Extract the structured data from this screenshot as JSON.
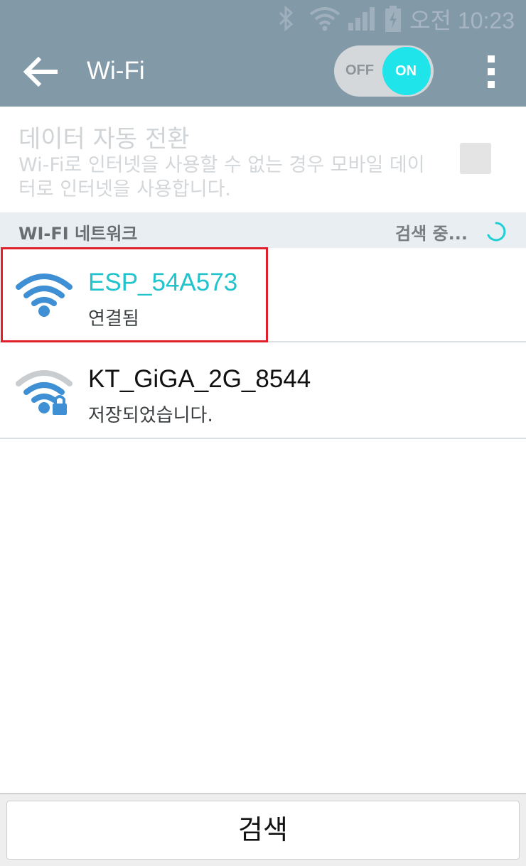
{
  "status_bar": {
    "time": "오전 10:23",
    "icons": [
      "bluetooth-icon",
      "wifi-signal-icon",
      "cell-signal-icon",
      "battery-charging-icon"
    ]
  },
  "app_bar": {
    "title": "Wi-Fi",
    "toggle": {
      "off_label": "OFF",
      "on_label": "ON",
      "state": "on"
    },
    "accent_color": "#1fe5ea",
    "bar_color": "#8299a8"
  },
  "auto_switch": {
    "title": "데이터 자동 전환",
    "description": "Wi-Fi로 인터넷을 사용할 수 없는 경우 모바일 데이터로  인터넷을 사용합니다.",
    "checked": false
  },
  "section": {
    "title": "WI-FI 네트워크",
    "scan_status": "검색 중..."
  },
  "networks": [
    {
      "name": "ESP_54A573",
      "status": "연결됨",
      "connected": true,
      "secured": false,
      "icon": "wifi-full-icon"
    },
    {
      "name": "KT_GiGA_2G_8544",
      "status": "저장되었습니다.",
      "connected": false,
      "secured": true,
      "icon": "wifi-lock-icon"
    }
  ],
  "footer": {
    "scan_button": "검색"
  }
}
